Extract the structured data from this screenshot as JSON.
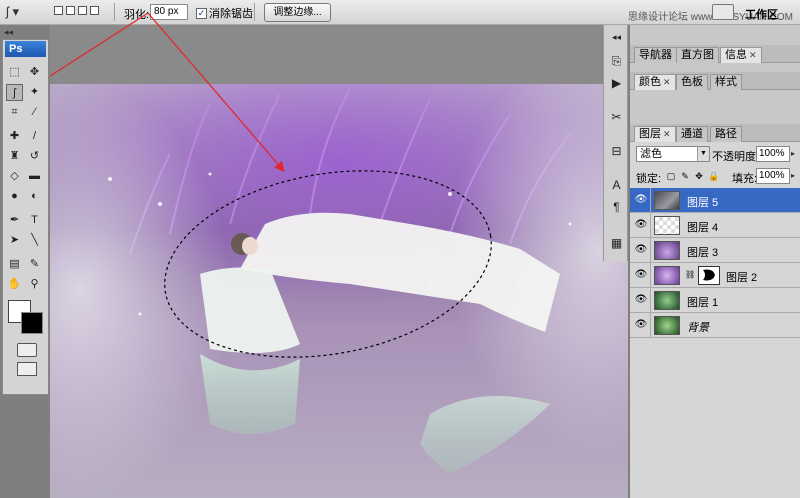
{
  "options_bar": {
    "feather_label": "羽化:",
    "feather_value": "80 px",
    "anti_alias_label": "消除锯齿",
    "anti_alias_checked": true,
    "refine_edge_label": "调整边缘...",
    "watermark": "思缘设计论坛 www.MISSYUAN.COM",
    "workspace_label": "工作区"
  },
  "toolbox": {
    "logo": "Ps"
  },
  "panels": {
    "top_tabs": [
      "导航器",
      "直方图",
      "信息"
    ],
    "mid_tabs": [
      "颜色",
      "色板",
      "样式"
    ],
    "layer_tabs": [
      "图层",
      "通道",
      "路径"
    ]
  },
  "layers_panel": {
    "blend_mode": "滤色",
    "opacity_label": "不透明度:",
    "opacity_value": "100%",
    "lock_label": "锁定:",
    "fill_label": "填充:",
    "fill_value": "100%",
    "layers": [
      {
        "name": "图层 5",
        "selected": true
      },
      {
        "name": "图层 4",
        "selected": false
      },
      {
        "name": "图层 3",
        "selected": false
      },
      {
        "name": "图层 2",
        "selected": false,
        "has_mask": true
      },
      {
        "name": "图层 1",
        "selected": false
      },
      {
        "name": "背景",
        "selected": false,
        "italic": true
      }
    ]
  },
  "colors": {
    "selected_layer": "#3769c4",
    "annotation_arrow": "#e0282c"
  }
}
